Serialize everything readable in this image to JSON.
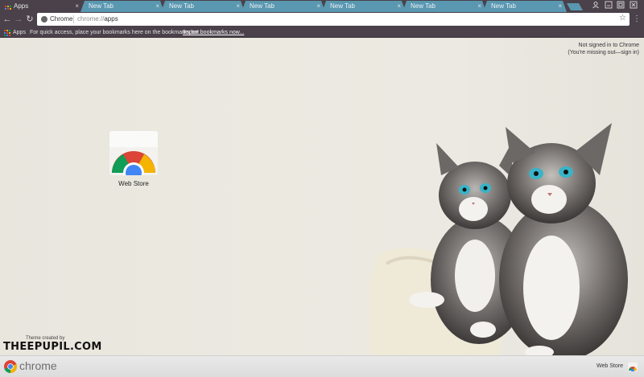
{
  "tabs": [
    {
      "title": "Apps",
      "active": true
    },
    {
      "title": "New Tab",
      "active": false
    },
    {
      "title": "New Tab",
      "active": false
    },
    {
      "title": "New Tab",
      "active": false
    },
    {
      "title": "New Tab",
      "active": false
    },
    {
      "title": "New Tab",
      "active": false
    },
    {
      "title": "New Tab",
      "active": false
    }
  ],
  "tab_close_glyph": "×",
  "toolbar": {
    "back_glyph": "←",
    "forward_glyph": "→",
    "reload_glyph": "↻",
    "site_chip": "Chrome",
    "url_scheme": "chrome://",
    "url_path": "apps",
    "star_glyph": "☆",
    "menu_glyph": "⋮"
  },
  "bookmarks": {
    "apps_label": "Apps",
    "message": "For quick access, place your bookmarks here on the bookmarks bar.",
    "import_link": "Import bookmarks now..."
  },
  "signin": {
    "line1": "Not signed in to Chrome",
    "line2_prefix": "(You're missing out—",
    "line2_link": "sign in",
    "line2_suffix": ")"
  },
  "apps": [
    {
      "label": "Web Store",
      "icon": "chrome-web-store-icon"
    }
  ],
  "theme_credit": {
    "small": "Theme created by",
    "brand": "THEEPUPIL.COM"
  },
  "bottom_bar": {
    "word": "chrome",
    "webstore_label": "Web Store"
  },
  "colors": {
    "frame": "#4a414a",
    "tab_inactive": "#5a97b0",
    "chrome_red": "#db4437",
    "chrome_green": "#0f9d58",
    "chrome_yellow": "#f4b400",
    "chrome_blue": "#4285f4"
  }
}
